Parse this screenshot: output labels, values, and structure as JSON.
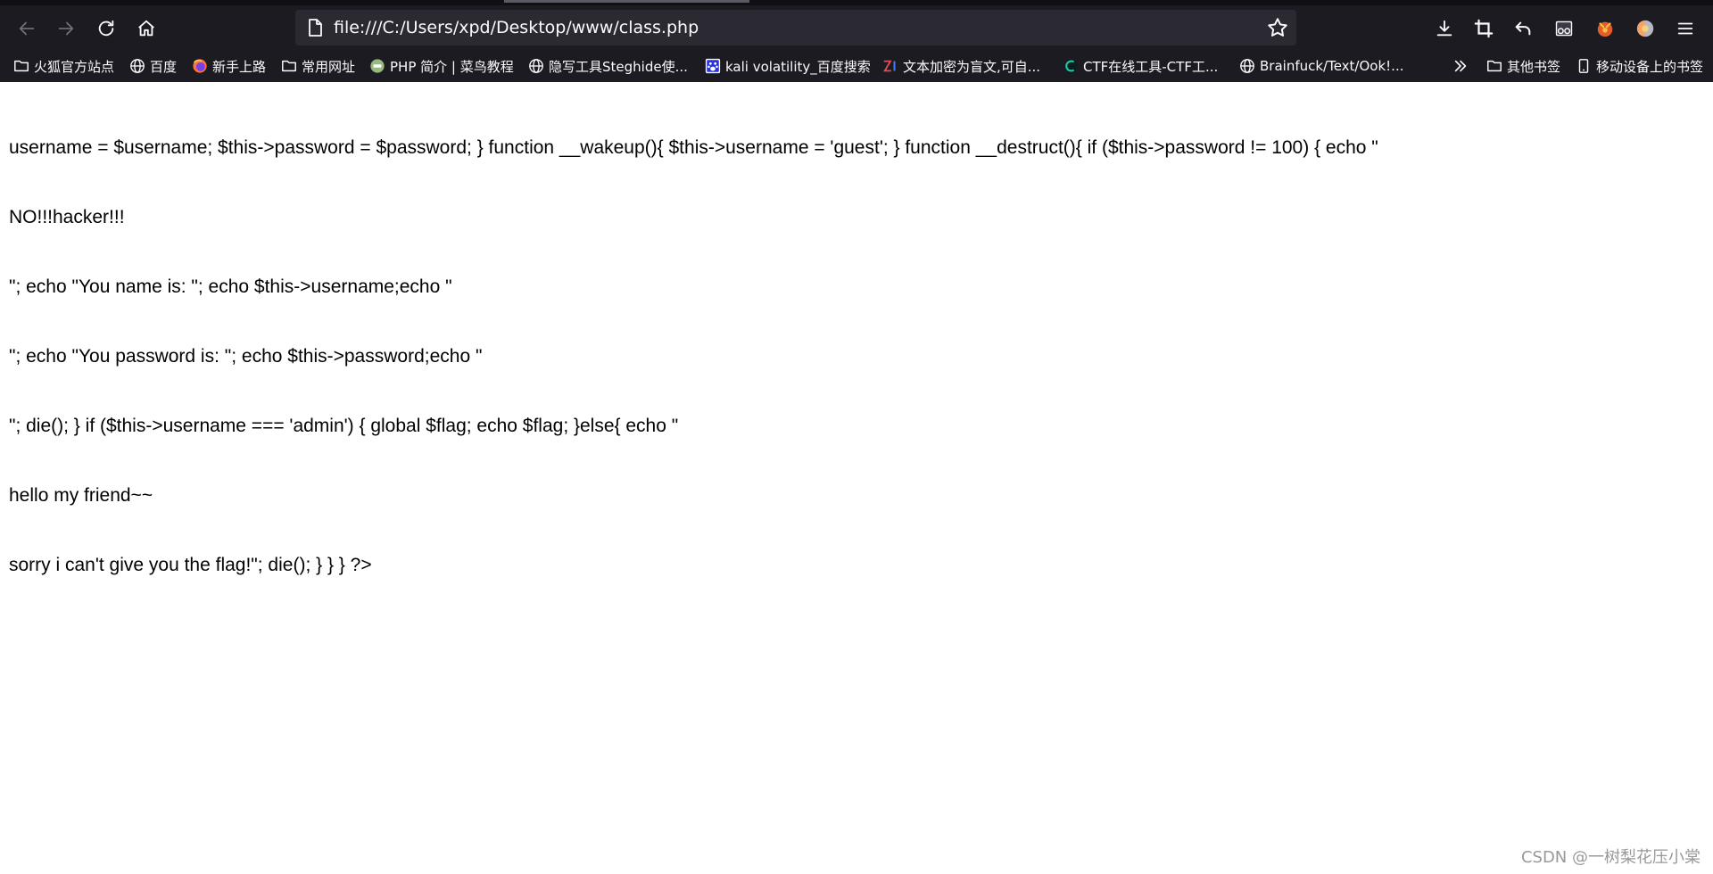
{
  "browser": {
    "url": "file:///C:/Users/xpd/Desktop/www/class.php",
    "bookmarks": [
      {
        "label": "火狐官方站点",
        "icon": "folder-icon"
      },
      {
        "label": "百度",
        "icon": "globe-icon"
      },
      {
        "label": "新手上路",
        "icon": "firefox-icon"
      },
      {
        "label": "常用网址",
        "icon": "folder-icon"
      },
      {
        "label": "PHP 简介 | 菜鸟教程",
        "icon": "runoob-icon"
      },
      {
        "label": "隐写工具Steghide使...",
        "icon": "globe-icon"
      },
      {
        "label": "kali volatility_百度搜索",
        "icon": "baidu-paw-icon"
      },
      {
        "label": "文本加密为盲文,可自...",
        "icon": "zi-icon"
      },
      {
        "label": "CTF在线工具-CTF工...",
        "icon": "ctf-icon"
      },
      {
        "label": "Brainfuck/Text/Ook!...",
        "icon": "globe-icon"
      }
    ],
    "other_bookmarks": "其他书签",
    "mobile_bookmarks": "移动设备上的书签"
  },
  "page": {
    "lines": [
      "username = $username; $this->password = $password; } function __wakeup(){ $this->username = 'guest'; } function __destruct(){ if ($this->password != 100) { echo \"",
      "NO!!!hacker!!!",
      "\"; echo \"You name is: \"; echo $this->username;echo \"",
      "\"; echo \"You password is: \"; echo $this->password;echo \"",
      "\"; die(); } if ($this->username === 'admin') { global $flag; echo $flag; }else{ echo \"",
      "hello my friend~~",
      "sorry i can't give you the flag!\"; die(); } } } ?>"
    ]
  },
  "watermark": "CSDN @一树梨花压小棠"
}
